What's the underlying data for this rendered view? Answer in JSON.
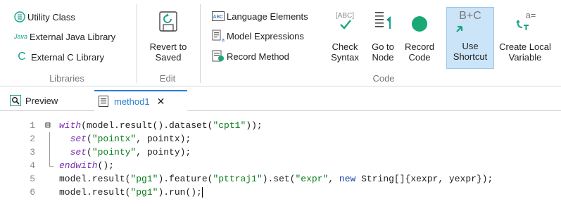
{
  "ribbon": {
    "libraries": {
      "items": [
        {
          "label": "Utility Class",
          "icon": "utility-class-icon"
        },
        {
          "label": "External Java Library",
          "icon": "java-library-icon",
          "icon_text": "Java"
        },
        {
          "label": "External C Library",
          "icon": "c-library-icon",
          "icon_text": "C"
        }
      ],
      "group_label": "Libraries"
    },
    "edit": {
      "revert_label_1": "Revert to",
      "revert_label_2": "Saved",
      "group_label": "Edit"
    },
    "code": {
      "list_items": [
        {
          "label": "Language Elements",
          "icon": "language-elements-icon",
          "icon_text": "ABC"
        },
        {
          "label": "Model Expressions",
          "icon": "model-expressions-icon"
        },
        {
          "label": "Record Method",
          "icon": "record-method-icon"
        }
      ],
      "check_syntax": {
        "line1": "Check",
        "line2": "Syntax",
        "icon_text": "[ABC]"
      },
      "go_to_node": {
        "line1": "Go to",
        "line2": "Node"
      },
      "record_code": {
        "line1": "Record",
        "line2": "Code"
      },
      "use_shortcut": {
        "line1": "Use",
        "line2": "Shortcut",
        "icon_text": "B+C"
      },
      "create_local_variable": {
        "line1": "Create Local",
        "line2": "Variable",
        "icon_text": "a="
      },
      "group_label": "Code"
    }
  },
  "tabs": {
    "preview": "Preview",
    "method": "method1",
    "close_symbol": "✕"
  },
  "editor": {
    "fold_symbol": "⊟",
    "lines": [
      {
        "num": "1",
        "parts": [
          [
            "kw",
            "with"
          ],
          [
            "t",
            "(model.result().dataset("
          ],
          [
            "str",
            "\"cpt1\""
          ],
          [
            "t",
            "));"
          ]
        ]
      },
      {
        "num": "2",
        "parts": [
          [
            "t",
            "  "
          ],
          [
            "kw",
            "set"
          ],
          [
            "t",
            "("
          ],
          [
            "str",
            "\"pointx\""
          ],
          [
            "t",
            ", pointx);"
          ]
        ]
      },
      {
        "num": "3",
        "parts": [
          [
            "t",
            "  "
          ],
          [
            "kw",
            "set"
          ],
          [
            "t",
            "("
          ],
          [
            "str",
            "\"pointy\""
          ],
          [
            "t",
            ", pointy);"
          ]
        ]
      },
      {
        "num": "4",
        "parts": [
          [
            "kw",
            "endwith"
          ],
          [
            "t",
            "();"
          ]
        ]
      },
      {
        "num": "5",
        "parts": [
          [
            "t",
            "model.result("
          ],
          [
            "str",
            "\"pg1\""
          ],
          [
            "t",
            ").feature("
          ],
          [
            "str",
            "\"pttraj1\""
          ],
          [
            "t",
            ").set("
          ],
          [
            "str",
            "\"expr\""
          ],
          [
            "t",
            ", "
          ],
          [
            "bluekw",
            "new"
          ],
          [
            "t",
            " String[]{xexpr, yexpr});"
          ]
        ]
      },
      {
        "num": "6",
        "parts": [
          [
            "t",
            "model.result("
          ],
          [
            "str",
            "\"pg1\""
          ],
          [
            "t",
            ").run();"
          ]
        ]
      }
    ]
  },
  "colors": {
    "accent": "#2a7fd0",
    "keyword": "#7d2fb3",
    "string": "#0b7d1b",
    "new_keyword": "#1a3db3",
    "green_record": "#1aa874"
  }
}
